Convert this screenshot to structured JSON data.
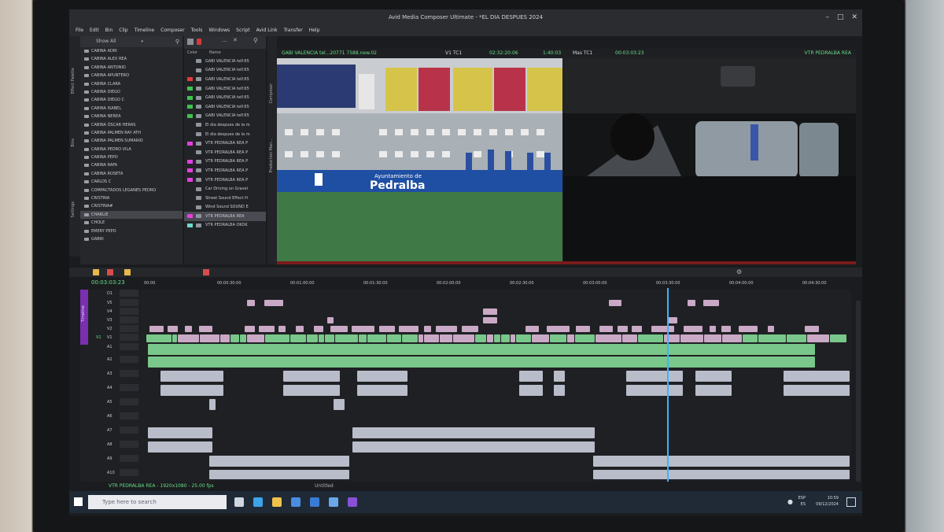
{
  "window": {
    "title": "Avid Media Composer Ultimate - *EL DIA DESPUES 2024",
    "menu": [
      "File",
      "Edit",
      "Bin",
      "Clip",
      "Timeline",
      "Composer",
      "Tools",
      "Windows",
      "Script",
      "Avid Link",
      "Transfer",
      "Help"
    ]
  },
  "side_tabs": [
    "Effect Palette",
    "Bins",
    "Settings"
  ],
  "bin_panel": {
    "header": "Show All",
    "items": [
      "CABINA ADRI",
      "CABINA ALEX REA",
      "CABINA ANTONIO",
      "CABINA APUNTERO",
      "CABINA CLARA",
      "CABINA DIEGO",
      "CABINA DIEGO C",
      "CABINA ISABEL",
      "CABINA NEREA",
      "CABINA ÓSCAR HERAS",
      "CABINA PALMEN RAY ATH",
      "CABINA PALMEN SUMARIO",
      "CABINA PEDRO VILA",
      "CABINA PEPO",
      "CABINA RAFA",
      "CABINA ROSETA",
      "CARLOS C",
      "COMPACTADOS LEGANES PEDRO",
      "CRISTINA",
      "CRISTINA#",
      "CHARLIE",
      "CHOLE",
      "EMERY PEPO",
      "GABRI"
    ],
    "selected_index": 20
  },
  "clip_panel": {
    "col_color": "Color",
    "col_name": "Name",
    "rows": [
      {
        "color": "",
        "name": "GABI VALENCIA telf.65"
      },
      {
        "color": "",
        "name": "GABI VALENCIA telf.65"
      },
      {
        "color": "#e23b3b",
        "name": "GABI VALENCIA telf.65"
      },
      {
        "color": "#3fc24f",
        "name": "GABI VALENCIA telf.65"
      },
      {
        "color": "#3fc24f",
        "name": "GABI VALENCIA telf.65"
      },
      {
        "color": "#3fc24f",
        "name": "GABI VALENCIA telf.65"
      },
      {
        "color": "#3fc24f",
        "name": "GABI VALENCIA telf.65"
      },
      {
        "color": "",
        "name": "El dia despues de la m"
      },
      {
        "color": "",
        "name": "El dia despues de la m"
      },
      {
        "color": "#e43fe0",
        "name": "VTR PEDRALBA REA P"
      },
      {
        "color": "",
        "name": "VTR PEDRALBA REA P"
      },
      {
        "color": "#e43fe0",
        "name": "VTR PEDRALBA REA P"
      },
      {
        "color": "#e43fe0",
        "name": "VTR PEDRALBA REA P"
      },
      {
        "color": "#e43fe0",
        "name": "VTR PEDRALBA REA P"
      },
      {
        "color": "",
        "name": "Car Driving on Gravel"
      },
      {
        "color": "",
        "name": "Street Sound Effect  H"
      },
      {
        "color": "",
        "name": "Wind Sound SOUND E"
      },
      {
        "color": "#e43fe0",
        "name": "VTR PEDRALBA REA"
      },
      {
        "color": "#6fd9c9",
        "name": "VTR PEDRALBA OKOK"
      }
    ],
    "selected_index": 17
  },
  "vertical_tabs": [
    "Composer",
    "Production Man..."
  ],
  "composer": {
    "source_clip": "GABI VALENCIA tel...20771 7588.new.02",
    "track_label": "V1  TC1",
    "source_tc": "02:32:20:06",
    "duration": "1:40:03",
    "mas_label": "Mas  TC1",
    "record_tc": "00:03:03:23",
    "record_sequence": "VTR PEDRALBA REA",
    "banner_line1": "Ayuntamiento de",
    "banner_line2": "Pedralba"
  },
  "timeline": {
    "timecode": "00:03:03:23",
    "ruler": [
      "00:00",
      "00:00:30:00",
      "00:01:00:00",
      "00:01:30:00",
      "00:02:00:00",
      "00:02:30:00",
      "00:03:00:00",
      "00:03:30:00",
      "00:04:00:00",
      "00:04:30:00"
    ],
    "tracks": [
      "D1",
      "V5",
      "V4",
      "V3",
      "V2",
      "V1",
      "A1",
      "A2",
      "A3",
      "A4",
      "A5",
      "A6",
      "A7",
      "A8",
      "A9",
      "A10"
    ],
    "side_label": "Timeline",
    "record_track": "V1",
    "status": "VTR PEDRALBA REA - 1920x1080 - 25.00 fps",
    "tab": "Untitled"
  },
  "taskbar": {
    "search_placeholder": "Type here to search",
    "lang": "ESP",
    "region": "ES",
    "time": "10:59",
    "date": "09/12/2024"
  },
  "colors": {
    "timecode_green": "#67e08a",
    "playhead": "#37b6ff",
    "video_clip": "#c9a9c6",
    "audio_green": "#79c78a",
    "magenta_marker": "#e43fe0"
  }
}
